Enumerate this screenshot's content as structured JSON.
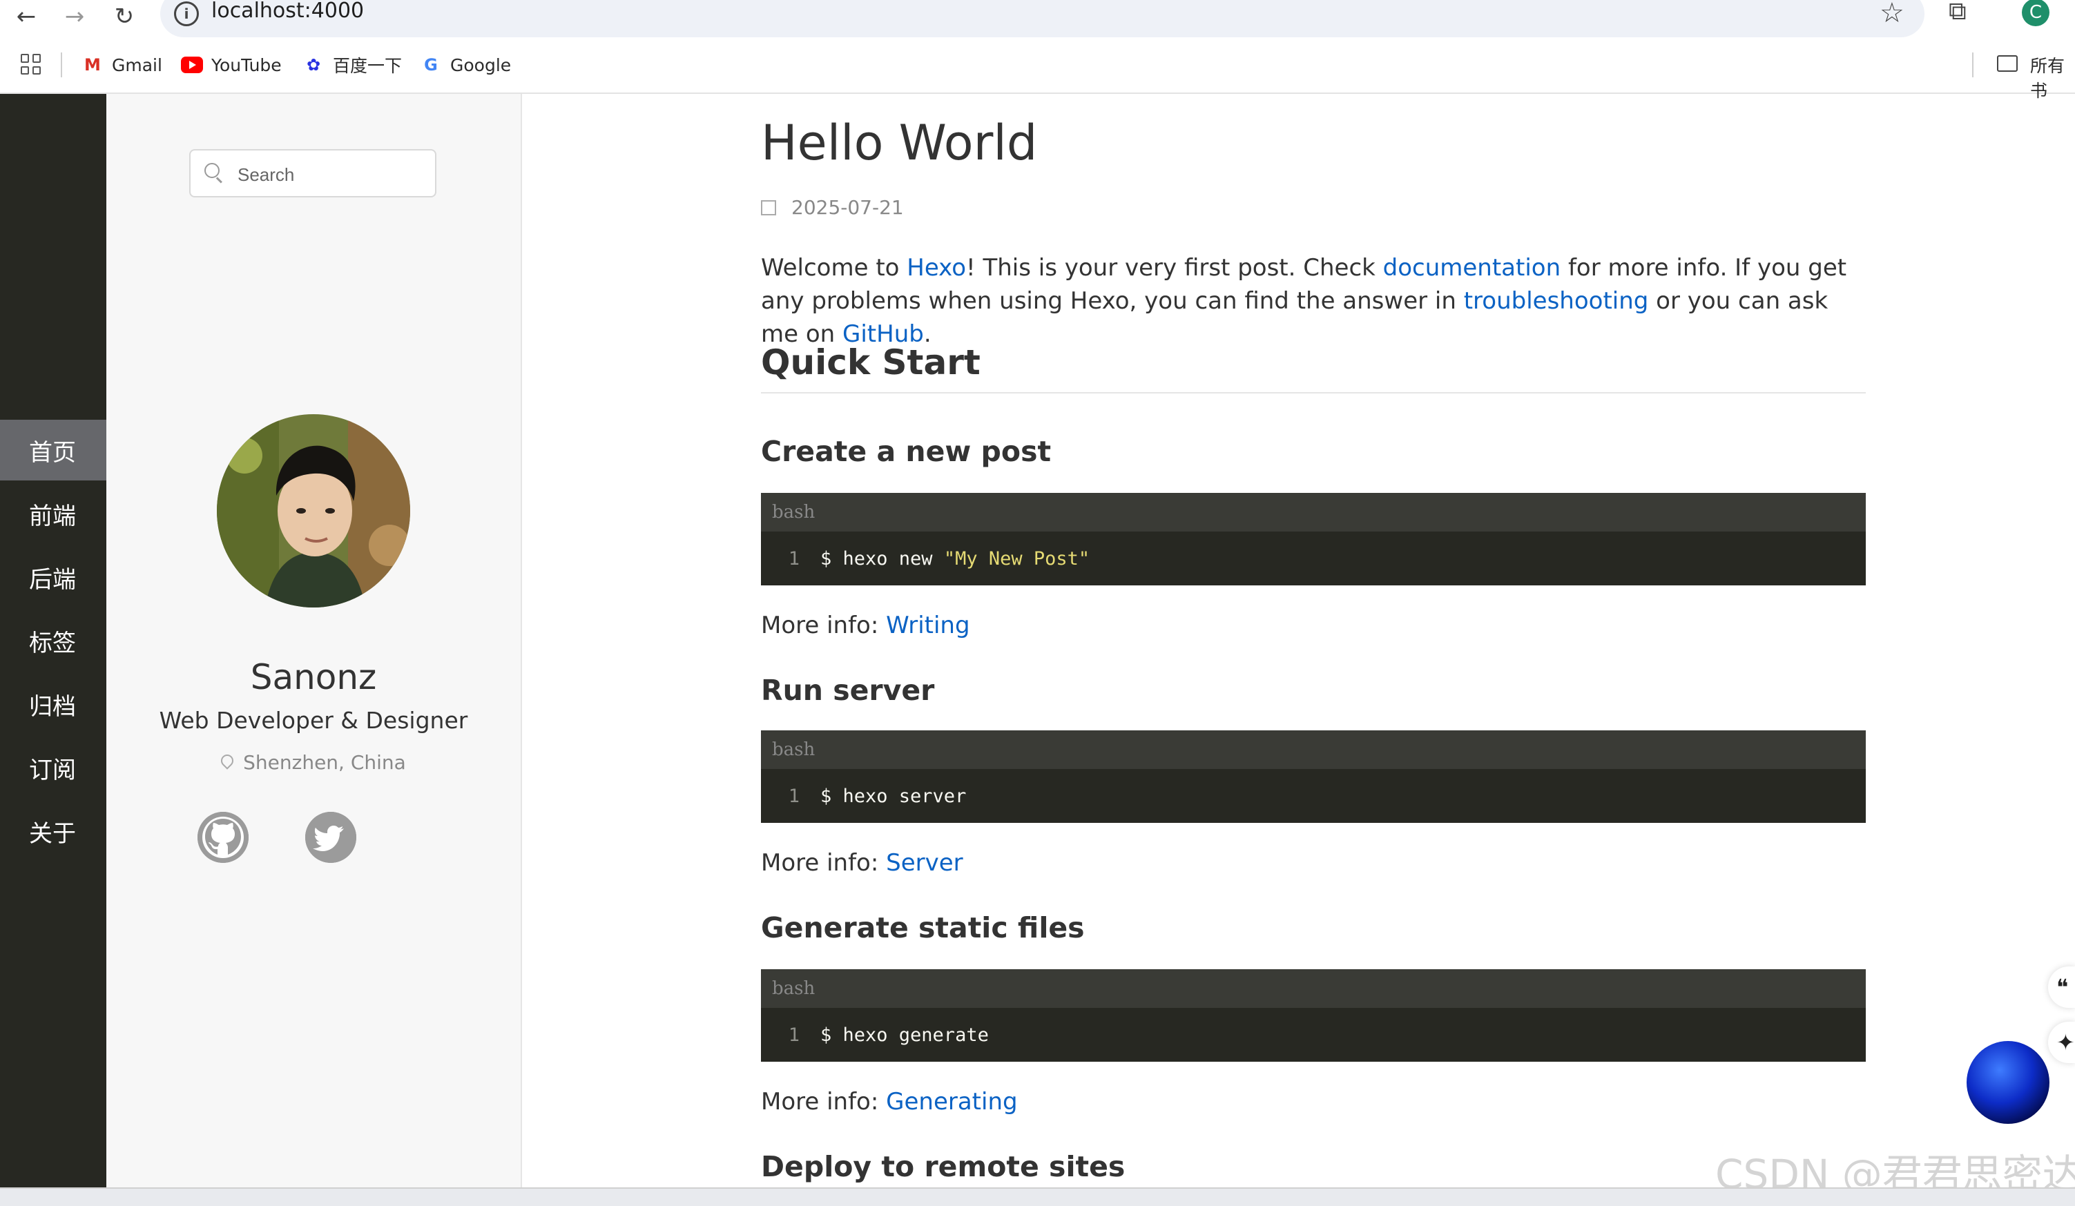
{
  "browser": {
    "url": "localhost:4000",
    "profile_initial": "C",
    "bookmarks": [
      {
        "label": "Gmail",
        "icon": "gmail-icon",
        "color": "#d93025"
      },
      {
        "label": "YouTube",
        "icon": "youtube-icon",
        "color": "#ff0000"
      },
      {
        "label": "百度一下",
        "icon": "baidu-icon",
        "color": "#2932e1"
      },
      {
        "label": "Google",
        "icon": "google-icon",
        "color": "#4285f4"
      }
    ],
    "bookmarks_right": "所有书"
  },
  "menu": {
    "items": [
      "首页",
      "前端",
      "后端",
      "标签",
      "归档",
      "订阅",
      "关于"
    ],
    "active_index": 0
  },
  "profile": {
    "search_placeholder": "Search",
    "name": "Sanonz",
    "title": "Web Developer & Designer",
    "location": "Shenzhen, China",
    "social": [
      "github-icon",
      "twitter-icon"
    ]
  },
  "post": {
    "title": "Hello World",
    "date": "2025-07-21",
    "intro": {
      "t1": "Welcome to ",
      "l1": "Hexo",
      "t2": "! This is your very first post. Check ",
      "l2": "documentation",
      "t3": " for more info. If you get any problems when using Hexo, you can find the answer in ",
      "l3": "troubleshooting",
      "t4": " or you can ask me on ",
      "l4": "GitHub",
      "t5": "."
    },
    "quick_start": "Quick Start",
    "sections": [
      {
        "heading": "Create a new post",
        "lang": "bash",
        "line": "1",
        "cmd": "$ hexo new ",
        "str": "\"My New Post\"",
        "more": "More info: ",
        "link": "Writing"
      },
      {
        "heading": "Run server",
        "lang": "bash",
        "line": "1",
        "cmd": "$ hexo server",
        "str": "",
        "more": "More info: ",
        "link": "Server"
      },
      {
        "heading": "Generate static files",
        "lang": "bash",
        "line": "1",
        "cmd": "$ hexo generate",
        "str": "",
        "more": "More info: ",
        "link": "Generating"
      }
    ],
    "next_heading": "Deploy to remote sites"
  },
  "watermark": "CSDN @君君思密达",
  "colors": {
    "link": "#0b62c4",
    "menu_bg": "#272822",
    "code_bg": "#272822"
  }
}
